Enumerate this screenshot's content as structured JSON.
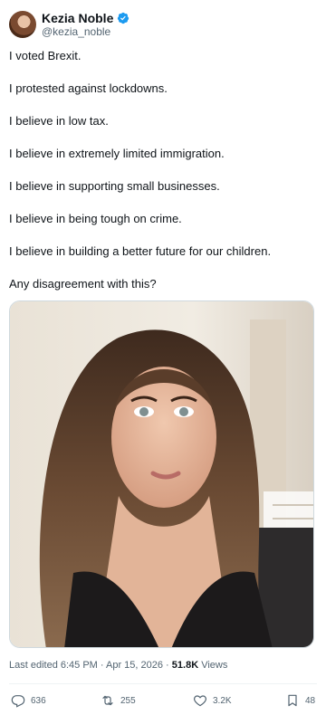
{
  "user": {
    "display_name": "Kezia Noble",
    "handle": "@kezia_noble",
    "verified": true,
    "avatar_icon": "profile-photo"
  },
  "tweet": {
    "lines": [
      "I voted Brexit.",
      "I protested against lockdowns.",
      "I believe in low tax.",
      "I believe in extremely limited immigration.",
      "I believe in supporting small businesses.",
      "I believe in being tough on crime.",
      "I believe in building a better future for our children.",
      "Any disagreement with this?"
    ]
  },
  "meta": {
    "edited_prefix": "Last edited 6:45 PM · Apr 15, 2026 · ",
    "views_count": "51.8K",
    "views_label": " Views"
  },
  "actions": {
    "reply": {
      "icon": "reply-icon",
      "count": "636"
    },
    "retweet": {
      "icon": "retweet-icon",
      "count": "255"
    },
    "like": {
      "icon": "heart-icon",
      "count": "3.2K"
    },
    "bookmark": {
      "icon": "bookmark-icon",
      "count": "48"
    }
  },
  "colors": {
    "verified": "#1d9bf0",
    "text": "#0f1419",
    "secondary": "#536471"
  }
}
